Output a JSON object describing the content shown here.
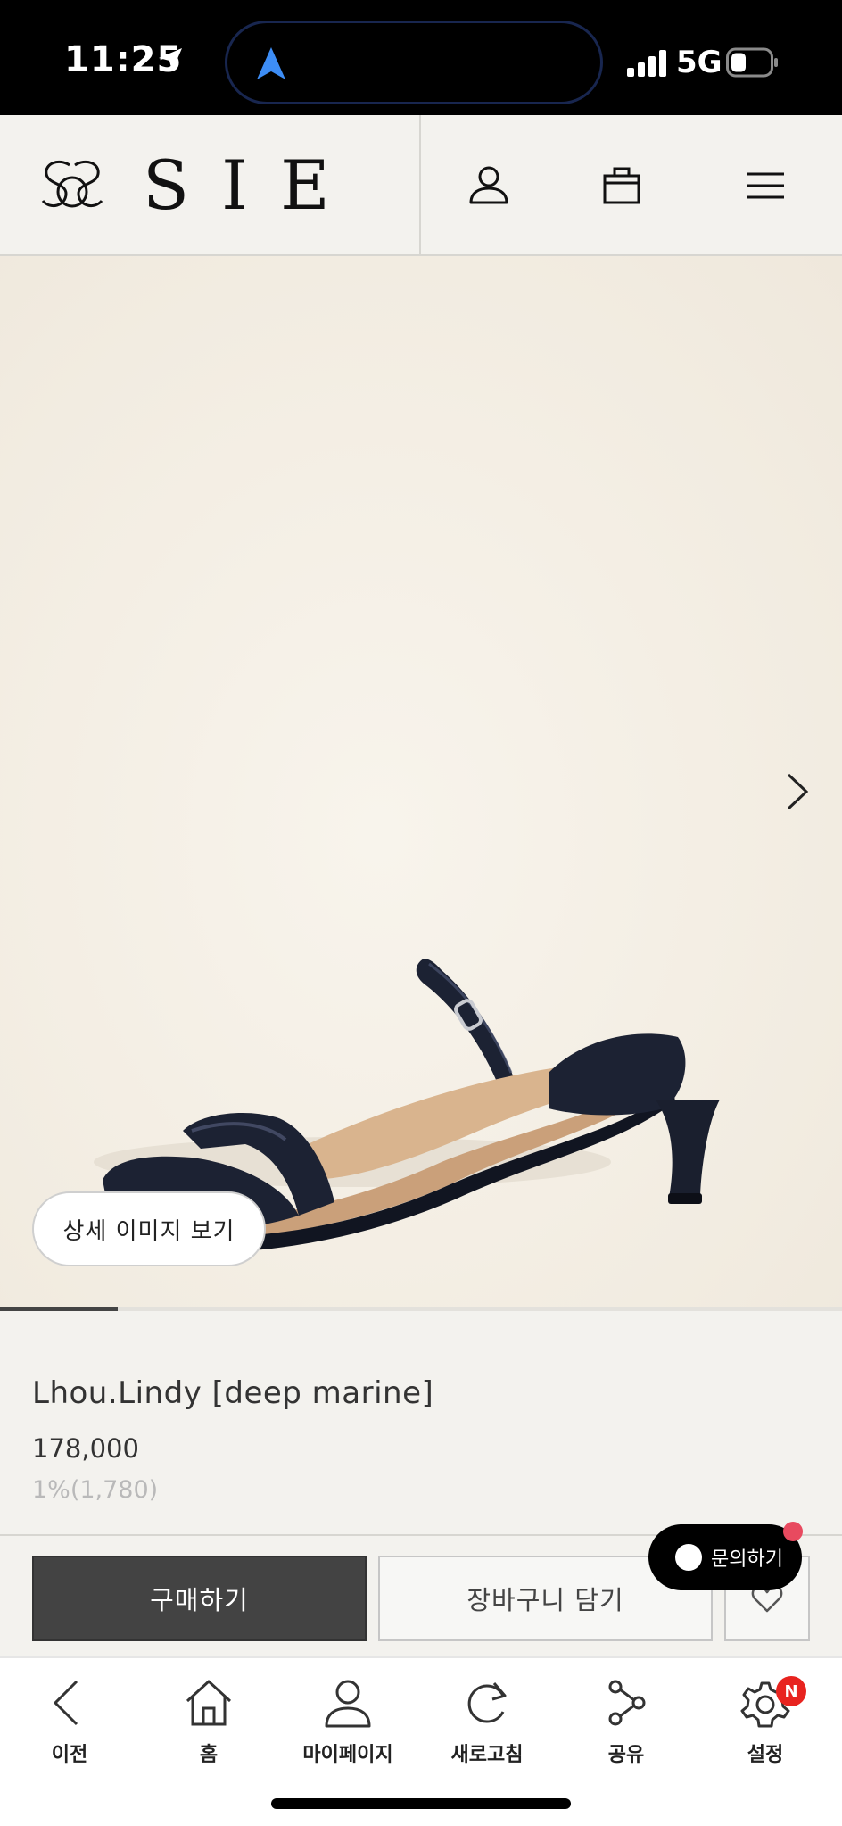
{
  "status_bar": {
    "time": "11:25",
    "network": "5G",
    "icons": [
      "location-arrow-icon",
      "navigation-arrow-icon",
      "signal-icon",
      "battery-icon"
    ]
  },
  "header": {
    "brand": "SIE",
    "icons": [
      "sie-logo-mark-icon",
      "user-icon",
      "shopping-bag-icon",
      "menu-icon"
    ]
  },
  "gallery": {
    "detail_button_label": "상세 이미지 보기",
    "progress_fraction": 0.14,
    "next_icon": "chevron-right-icon"
  },
  "product": {
    "name": "Lhou.Lindy [deep marine]",
    "price": "178,000",
    "point": "1%(1,780)"
  },
  "actions": {
    "buy_label": "구매하기",
    "cart_label": "장바구니 담기",
    "wish_icon": "heart-icon",
    "inquiry_label": "문의하기"
  },
  "bottom_nav": {
    "items": [
      {
        "label": "이전",
        "icon": "back-chevron-icon"
      },
      {
        "label": "홈",
        "icon": "home-icon"
      },
      {
        "label": "마이페이지",
        "icon": "person-icon"
      },
      {
        "label": "새로고침",
        "icon": "refresh-icon"
      },
      {
        "label": "공유",
        "icon": "share-icon"
      },
      {
        "label": "설정",
        "icon": "gear-icon"
      }
    ],
    "settings_badge": "N"
  },
  "colors": {
    "background": "#f3f2ee",
    "buy_button": "#434343",
    "inquiry_bubble": "#000000",
    "notification_badge": "#e8231f",
    "shoe": "#1c2233"
  }
}
